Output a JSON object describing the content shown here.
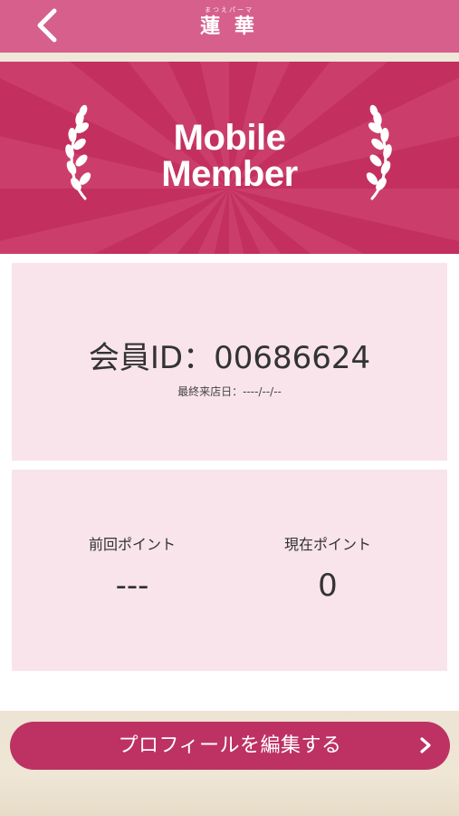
{
  "header": {
    "logo_ruby": "まつえパーマ",
    "logo_text": "蓮 華",
    "back_icon": "chevron-left-icon"
  },
  "banner": {
    "title_line1": "Mobile",
    "title_line2": "Member",
    "left_icon": "laurel-icon",
    "right_icon": "laurel-icon"
  },
  "member": {
    "id_label": "会員ID：",
    "id_value": "00686624",
    "last_visit_label": "最終来店日：",
    "last_visit_value": "----/--/--"
  },
  "points": {
    "previous_label": "前回ポイント",
    "previous_value": "---",
    "current_label": "現在ポイント",
    "current_value": "0"
  },
  "footer": {
    "edit_profile_label": "プロフィールを編集する",
    "chevron_icon": "chevron-right-icon"
  },
  "colors": {
    "header_pink": "#d6608b",
    "banner_crimson": "#c3305f",
    "card_pink": "#f8e4ea",
    "button_crimson": "#bd3263",
    "cream": "#f1ebe0"
  }
}
